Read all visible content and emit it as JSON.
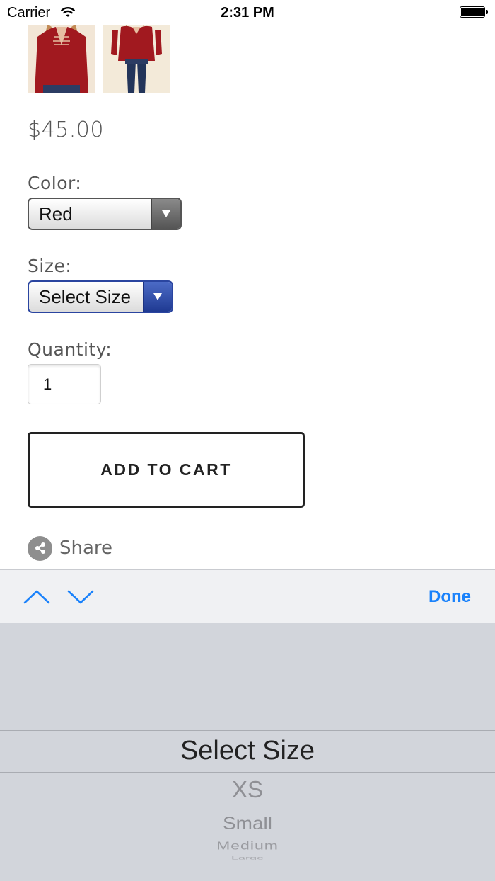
{
  "status_bar": {
    "carrier": "Carrier",
    "time": "2:31 PM"
  },
  "product": {
    "thumbnails": [
      "thumbnail-image-1",
      "thumbnail-image-2"
    ],
    "price": "$45.00",
    "color_label": "Color:",
    "color_value": "Red",
    "size_label": "Size:",
    "size_value": "Select Size",
    "quantity_label": "Quantity:",
    "quantity_value": "1",
    "add_to_cart": "ADD TO CART",
    "share": "Share"
  },
  "keyboard_toolbar": {
    "prev_icon": "chevron-up-icon",
    "next_icon": "chevron-down-icon",
    "done": "Done"
  },
  "picker": {
    "selected": "Select Size",
    "options": [
      "XS",
      "Small",
      "Medium",
      "Large"
    ]
  },
  "colors": {
    "accent": "#1a82fb",
    "picker_bg": "#d2d5db",
    "toolbar_bg": "#f0f1f3",
    "select_blue": "#2a45a0"
  }
}
